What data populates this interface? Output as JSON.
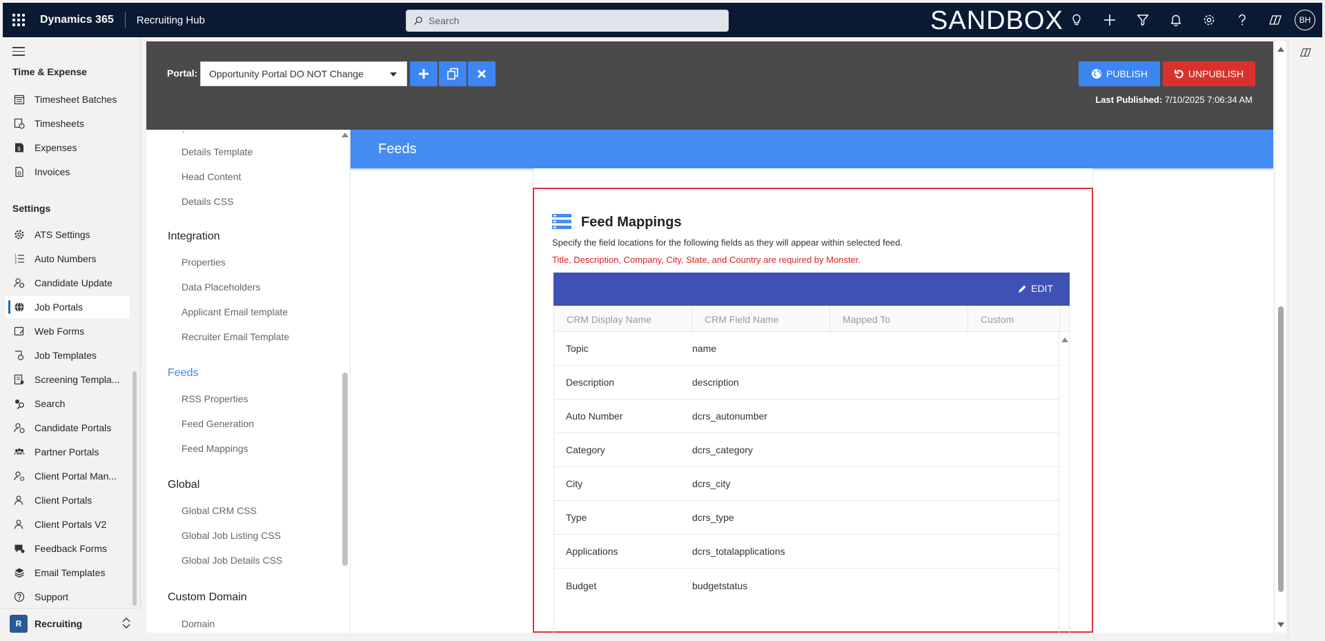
{
  "topbar": {
    "brand": "Dynamics 365",
    "app_name": "Recruiting Hub",
    "search_placeholder": "Search",
    "environment": "SANDBOX",
    "avatar_initials": "BH"
  },
  "leftnav": {
    "sections": [
      {
        "title": "Time & Expense",
        "items": [
          {
            "label": "Timesheet Batches",
            "icon": "calendar-list-icon"
          },
          {
            "label": "Timesheets",
            "icon": "timesheet-icon"
          },
          {
            "label": "Expenses",
            "icon": "expense-icon"
          },
          {
            "label": "Invoices",
            "icon": "invoice-icon"
          }
        ]
      },
      {
        "title": "Settings",
        "items": [
          {
            "label": "ATS Settings",
            "icon": "gear-icon"
          },
          {
            "label": "Auto Numbers",
            "icon": "numbered-list-icon"
          },
          {
            "label": "Candidate Update",
            "icon": "person-sync-icon"
          },
          {
            "label": "Job Portals",
            "icon": "globe-icon"
          },
          {
            "label": "Web Forms",
            "icon": "form-icon"
          },
          {
            "label": "Job Templates",
            "icon": "template-icon"
          },
          {
            "label": "Screening Templa...",
            "icon": "screening-icon"
          },
          {
            "label": "Search",
            "icon": "search-settings-icon"
          },
          {
            "label": "Candidate Portals",
            "icon": "person-globe-icon"
          },
          {
            "label": "Partner Portals",
            "icon": "people-group-icon"
          },
          {
            "label": "Client Portal Man...",
            "icon": "person-gear-icon"
          },
          {
            "label": "Client Portals",
            "icon": "person-icon"
          },
          {
            "label": "Client Portals V2",
            "icon": "person-icon"
          },
          {
            "label": "Feedback Forms",
            "icon": "feedback-icon"
          },
          {
            "label": "Email Templates",
            "icon": "layers-icon"
          },
          {
            "label": "Support",
            "icon": "help-circle-icon"
          }
        ]
      }
    ],
    "active_item": "Job Portals",
    "area_badge": "R",
    "area_label": "Recruiting"
  },
  "portalbar": {
    "portal_label": "Portal:",
    "portal_selected": "Opportunity Portal DO NOT Change",
    "publish_label": "PUBLISH",
    "unpublish_label": "UNPUBLISH",
    "last_published_label": "Last Published:",
    "last_published_value": "7/10/2025 7:06:34 AM"
  },
  "submenu": {
    "top_items": [
      "Details Template",
      "Head Content",
      "Details CSS"
    ],
    "groups": [
      {
        "title": "Integration",
        "items": [
          "Properties",
          "Data Placeholders",
          "Applicant Email template",
          "Recruiter Email Template"
        ]
      },
      {
        "title": "Feeds",
        "items": [
          "RSS Properties",
          "Feed Generation",
          "Feed Mappings"
        ]
      },
      {
        "title": "Global",
        "items": [
          "Global CRM CSS",
          "Global Job Listing CSS",
          "Global Job Details CSS"
        ]
      },
      {
        "title": "Custom Domain",
        "items": [
          "Domain"
        ]
      }
    ],
    "active_group": "Feeds"
  },
  "page_header": "Feeds",
  "feed_mappings": {
    "title": "Feed Mappings",
    "description": "Specify the field locations for the following fields as they will appear within selected feed.",
    "required_note": "Title, Description, Company, City, State, and Country are required by Monster.",
    "edit_label": "EDIT",
    "columns": [
      "CRM Display Name",
      "CRM Field Name",
      "Mapped To",
      "Custom"
    ],
    "rows": [
      {
        "display": "Topic",
        "field": "name"
      },
      {
        "display": "Description",
        "field": "description"
      },
      {
        "display": "Auto Number",
        "field": "dcrs_autonumber"
      },
      {
        "display": "Category",
        "field": "dcrs_category"
      },
      {
        "display": "City",
        "field": "dcrs_city"
      },
      {
        "display": "Type",
        "field": "dcrs_type"
      },
      {
        "display": "Applications",
        "field": "dcrs_totalapplications"
      },
      {
        "display": "Budget",
        "field": "budgetstatus"
      }
    ]
  },
  "colors": {
    "topbar": "#0b1a33",
    "portal_bar": "#4a4a4a",
    "accent_blue": "#3d85f0",
    "feeds_header": "#448bf2",
    "table_toolbar": "#3f51b5",
    "unpublish_red": "#d9322c",
    "highlight_border": "#e0313a"
  }
}
